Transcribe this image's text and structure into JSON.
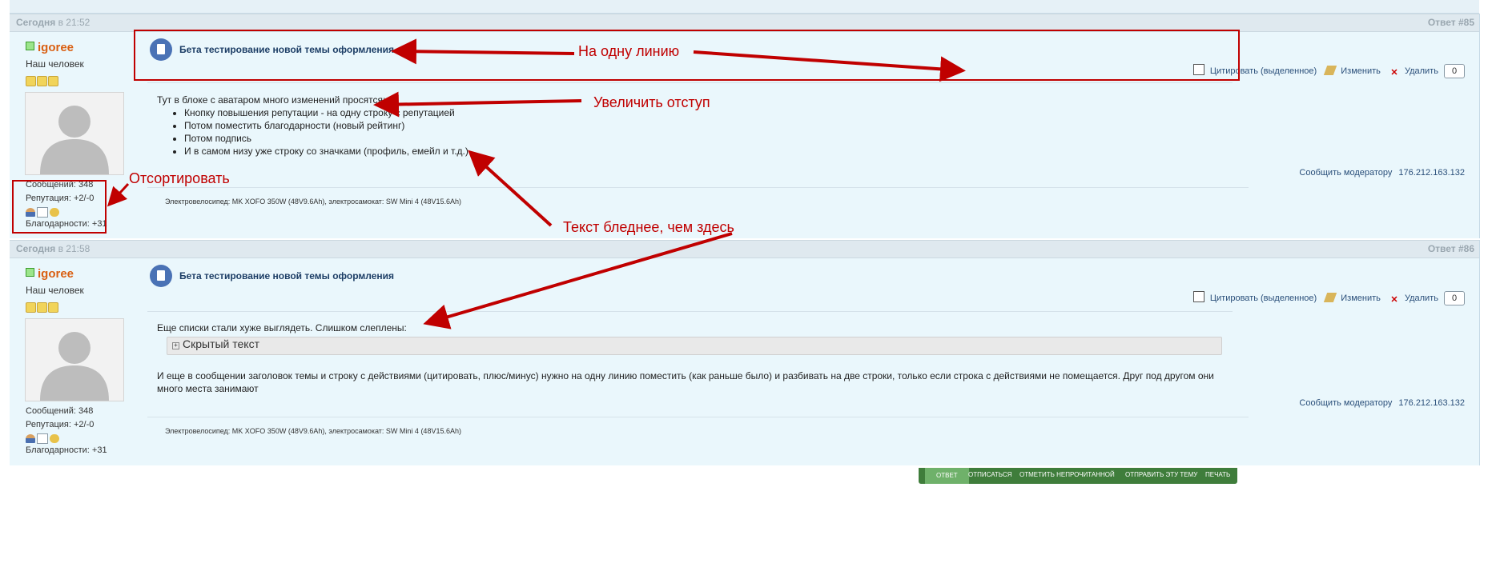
{
  "top_strip_text": "",
  "posts": [
    {
      "date_label": "Сегодня",
      "time_label": "в 21:52",
      "reply_number": "Ответ #85",
      "author": {
        "name": "igoree",
        "rank": "Наш человек",
        "messages": "Сообщений: 348",
        "reputation": "Репутация: +2/-0",
        "thanks": "Благодарности: +31"
      },
      "topic_title": "Бета тестирование новой темы оформления",
      "actions": {
        "quote": "Цитировать (выделенное)",
        "edit": "Изменить",
        "delete": "Удалить",
        "rep_value": "0"
      },
      "body_intro": "Тут в блоке с аватаром много изменений просятся:",
      "body_list": [
        "Кнопку повышения репутации - на одну строку с репутацией",
        "Потом поместить благодарности (новый рейтинг)",
        "Потом подпись",
        "И в самом низу уже строку со значками (профиль, емейл и т.д.)"
      ],
      "report": "Сообщить модератору",
      "ip": "176.212.163.132",
      "signature": "Электровелосипед: MK XOFO 350W (48V9.6Ah), электросамокат: SW Mini 4 (48V15.6Ah)"
    },
    {
      "date_label": "Сегодня",
      "time_label": "в 21:58",
      "reply_number": "Ответ #86",
      "author": {
        "name": "igoree",
        "rank": "Наш человек",
        "messages": "Сообщений: 348",
        "reputation": "Репутация: +2/-0",
        "thanks": "Благодарности: +31"
      },
      "topic_title": "Бета тестирование новой темы оформления",
      "actions": {
        "quote": "Цитировать (выделенное)",
        "edit": "Изменить",
        "delete": "Удалить",
        "rep_value": "0"
      },
      "body_intro": "Еще списки стали хуже выглядеть. Слишком слеплены:",
      "spoiler_label": "Скрытый текст",
      "body_outro": "И еще в сообщении заголовок темы и строку с действиями (цитировать, плюс/минус) нужно на одну линию поместить (как раньше было) и разбивать на две строки, только если строка с действиями не помещается. Друг под другом они много места занимают",
      "report": "Сообщить модератору",
      "ip": "176.212.163.132",
      "signature": "Электровелосипед: MK XOFO 350W (48V9.6Ah), электросамокат: SW Mini 4 (48V15.6Ah)"
    }
  ],
  "bottom_bar": {
    "reply": "ОТВЕТ",
    "unsubscribe": "ОТПИСАТЬСЯ",
    "mark_unread": "ОТМЕТИТЬ НЕПРОЧИТАННОЙ",
    "send_topic": "ОТПРАВИТЬ ЭТУ ТЕМУ",
    "print": "ПЕЧАТЬ"
  },
  "annotations": {
    "one_line": "На одну линию",
    "increase_indent": "Увеличить отступ",
    "sort": "Отсортировать",
    "text_paler": "Текст бледнее, чем здесь"
  },
  "annotation_color": "#c00000"
}
